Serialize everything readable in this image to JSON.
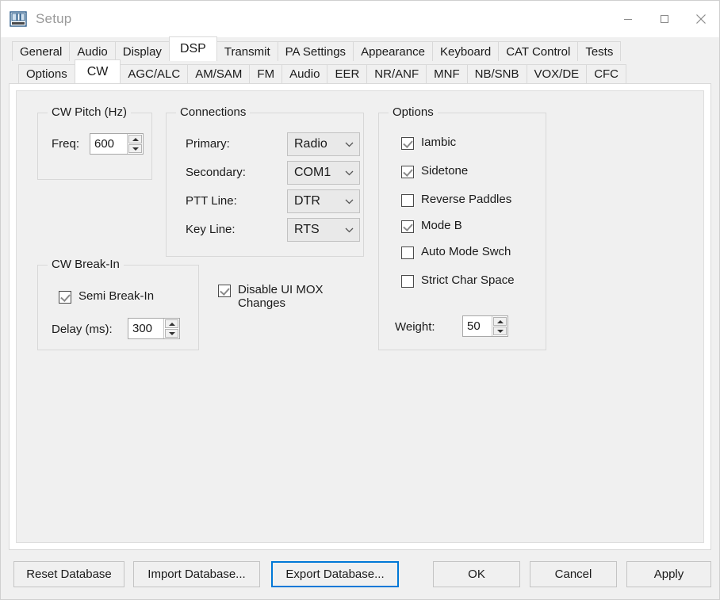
{
  "window": {
    "title": "Setup",
    "icon": "radio-panel-icon",
    "controls": {
      "minimize": "minimize-icon",
      "maximize": "maximize-icon",
      "close": "close-icon"
    }
  },
  "tabs_primary": {
    "items": [
      {
        "label": "General",
        "active": false
      },
      {
        "label": "Audio",
        "active": false
      },
      {
        "label": "Display",
        "active": false
      },
      {
        "label": "DSP",
        "active": true
      },
      {
        "label": "Transmit",
        "active": false
      },
      {
        "label": "PA Settings",
        "active": false
      },
      {
        "label": "Appearance",
        "active": false
      },
      {
        "label": "Keyboard",
        "active": false
      },
      {
        "label": "CAT Control",
        "active": false
      },
      {
        "label": "Tests",
        "active": false
      }
    ]
  },
  "tabs_secondary": {
    "items": [
      {
        "label": "Options",
        "active": false
      },
      {
        "label": "CW",
        "active": true
      },
      {
        "label": "AGC/ALC",
        "active": false
      },
      {
        "label": "AM/SAM",
        "active": false
      },
      {
        "label": "FM",
        "active": false
      },
      {
        "label": "Audio",
        "active": false
      },
      {
        "label": "EER",
        "active": false
      },
      {
        "label": "NR/ANF",
        "active": false
      },
      {
        "label": "MNF",
        "active": false
      },
      {
        "label": "NB/SNB",
        "active": false
      },
      {
        "label": "VOX/DE",
        "active": false
      },
      {
        "label": "CFC",
        "active": false
      }
    ]
  },
  "cw_pitch": {
    "group_label": "CW Pitch (Hz)",
    "freq_label": "Freq:",
    "freq_value": "600"
  },
  "connections": {
    "group_label": "Connections",
    "rows": [
      {
        "label": "Primary:",
        "value": "Radio"
      },
      {
        "label": "Secondary:",
        "value": "COM1"
      },
      {
        "label": "PTT Line:",
        "value": "DTR"
      },
      {
        "label": "Key Line:",
        "value": "RTS"
      }
    ]
  },
  "cw_breakin": {
    "group_label": "CW Break-In",
    "semi_label": "Semi Break-In",
    "semi_checked": true,
    "delay_label": "Delay (ms):",
    "delay_value": "300"
  },
  "disable_mox": {
    "label": "Disable UI MOX\nChanges",
    "checked": true
  },
  "options": {
    "group_label": "Options",
    "checkboxes": [
      {
        "label": "Iambic",
        "checked": true
      },
      {
        "label": "Sidetone",
        "checked": true
      },
      {
        "label": "Reverse Paddles",
        "checked": false
      },
      {
        "label": "Mode B",
        "checked": true
      },
      {
        "label": "Auto Mode Swch",
        "checked": false
      },
      {
        "label": "Strict Char Space",
        "checked": false
      }
    ],
    "weight_label": "Weight:",
    "weight_value": "50"
  },
  "buttons": {
    "reset_database": "Reset Database",
    "import_database": "Import Database...",
    "export_database": "Export Database...",
    "ok": "OK",
    "cancel": "Cancel",
    "apply": "Apply"
  },
  "colors": {
    "focus_border": "#0078d7",
    "dialog_bg": "#f0f0f0",
    "titlebar_bg": "#ffffff",
    "title_text": "#9a9a9a"
  }
}
